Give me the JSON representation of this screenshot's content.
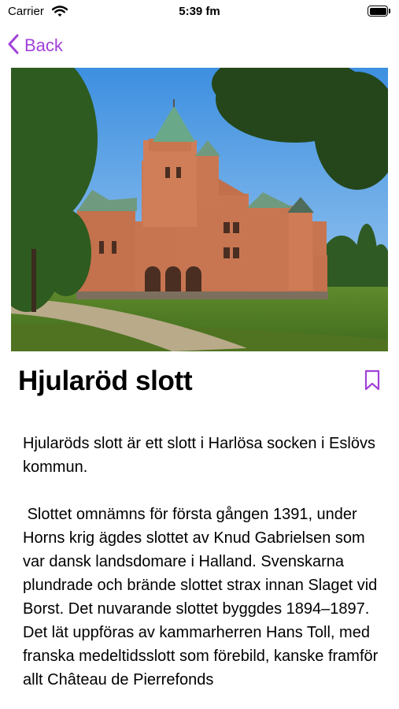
{
  "status_bar": {
    "carrier": "Carrier",
    "time": "5:39 fm"
  },
  "nav": {
    "back_label": "Back"
  },
  "article": {
    "title": "Hjularöd slott",
    "paragraphs": [
      "Hjularöds slott är ett slott i Harlösa socken i Eslövs kommun.",
      " Slottet omnämns för första gången 1391, under Horns krig ägdes slottet av Knud Gabrielsen som var dansk landsdomare i Halland. Svenskarna plundrade och brände slottet strax innan Slaget vid Borst. Det nuvarande slottet byggdes 1894–1897. Det lät uppföras av kammarherren Hans Toll, med franska medeltidsslott som förebild, kanske framför allt Château de Pierrefonds"
    ]
  },
  "colors": {
    "accent": "#a142d8"
  },
  "icons": {
    "back": "chevron-left-icon",
    "bookmark": "bookmark-icon",
    "wifi": "wifi-icon",
    "battery": "battery-icon"
  }
}
